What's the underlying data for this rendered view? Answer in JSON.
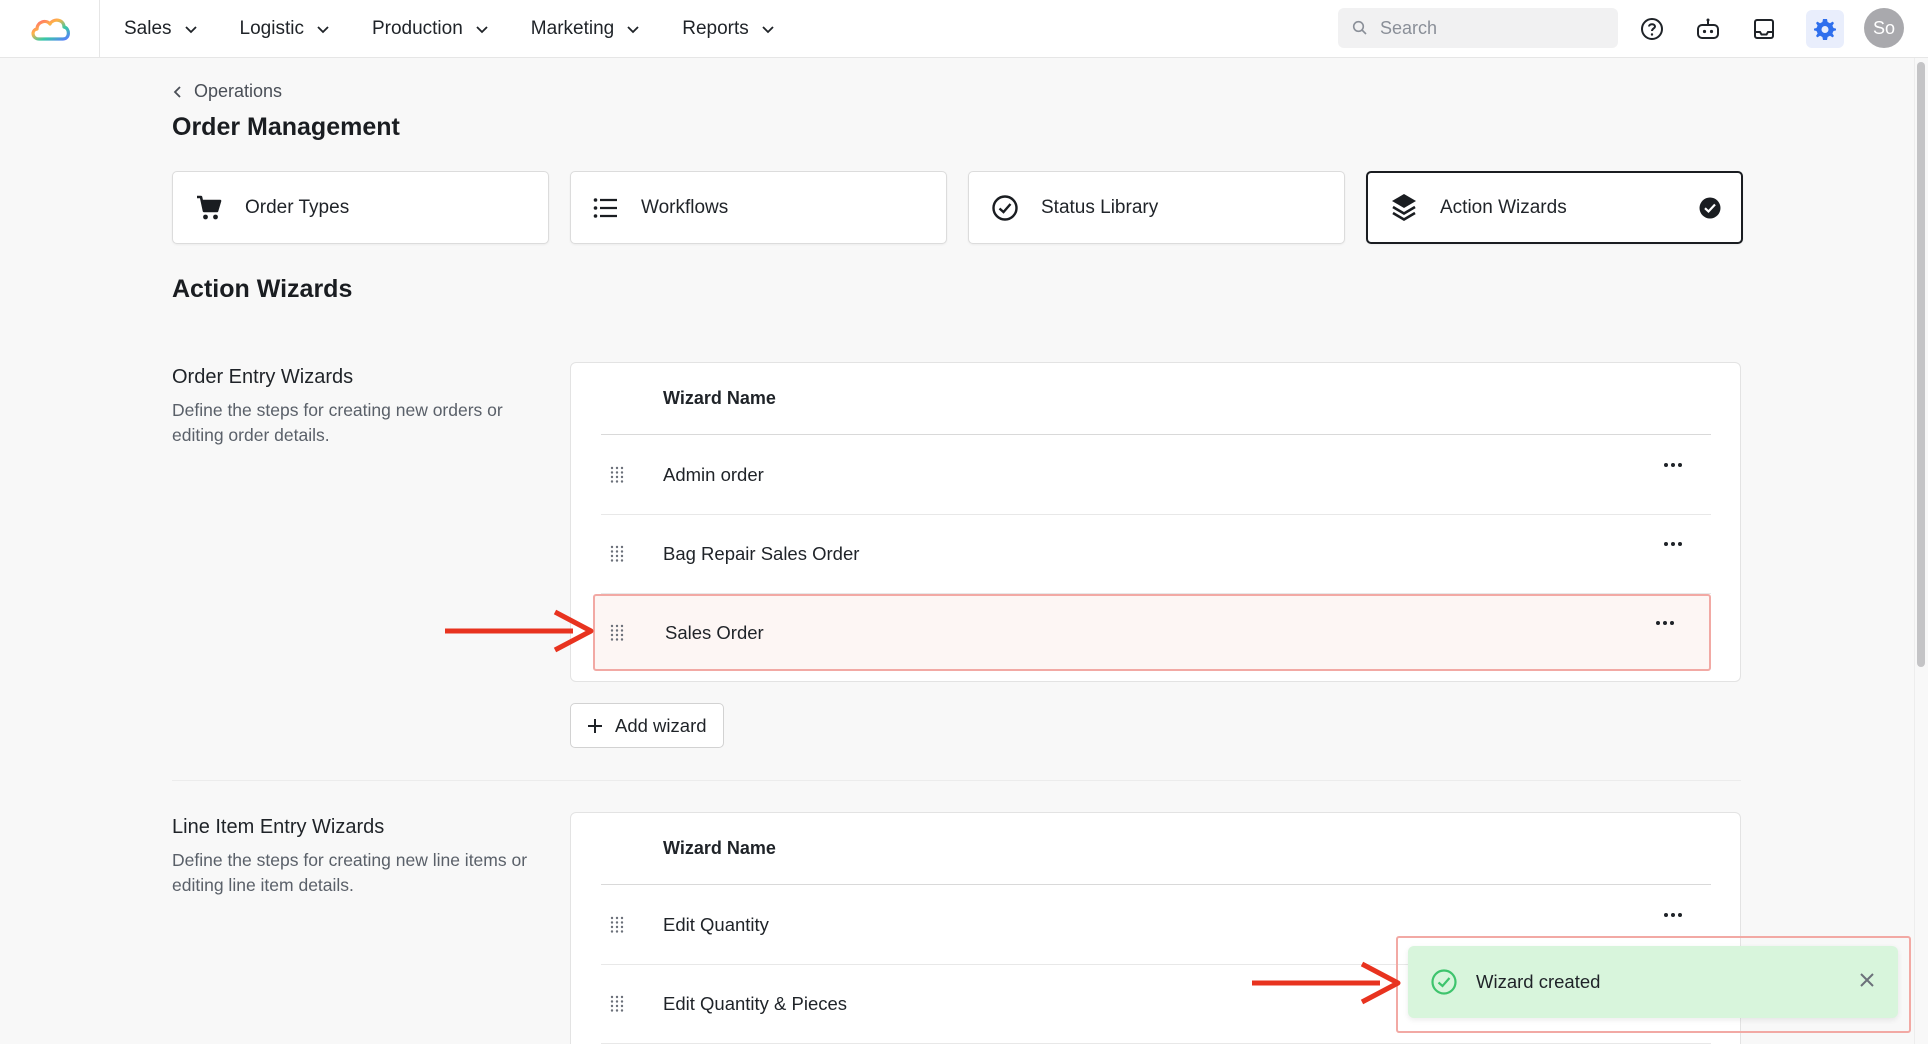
{
  "nav": {
    "items": [
      {
        "label": "Sales"
      },
      {
        "label": "Logistic"
      },
      {
        "label": "Production"
      },
      {
        "label": "Marketing"
      },
      {
        "label": "Reports"
      }
    ],
    "search_placeholder": "Search",
    "avatar_initials": "So",
    "icons": [
      "help-icon",
      "robot-icon",
      "inbox-icon",
      "gear-icon"
    ]
  },
  "breadcrumb": {
    "label": "Operations"
  },
  "page": {
    "title": "Order Management"
  },
  "cards": [
    {
      "label": "Order Types",
      "icon": "cart-icon"
    },
    {
      "label": "Workflows",
      "icon": "list-icon"
    },
    {
      "label": "Status Library",
      "icon": "check-circle-icon"
    },
    {
      "label": "Action Wizards",
      "icon": "layers-icon",
      "selected": true
    }
  ],
  "section": {
    "heading": "Action Wizards"
  },
  "order_entry": {
    "title": "Order Entry Wizards",
    "description": "Define the steps for creating new orders or editing order details.",
    "column_header": "Wizard Name",
    "rows": [
      {
        "name": "Admin order"
      },
      {
        "name": "Bag Repair Sales Order"
      },
      {
        "name": "Sales Order",
        "highlighted": true
      }
    ],
    "add_label": "Add wizard"
  },
  "line_item_entry": {
    "title": "Line Item Entry Wizards",
    "description": "Define the steps for creating new line items or editing line item details.",
    "column_header": "Wizard Name",
    "rows": [
      {
        "name": "Edit Quantity"
      },
      {
        "name": "Edit Quantity & Pieces"
      }
    ]
  },
  "toast": {
    "message": "Wizard created",
    "status_color": "#3ec46d"
  },
  "colors": {
    "annotation_red": "#e8331f",
    "highlight_border": "#f2a9a4",
    "accent_blue": "#2f6fed"
  }
}
